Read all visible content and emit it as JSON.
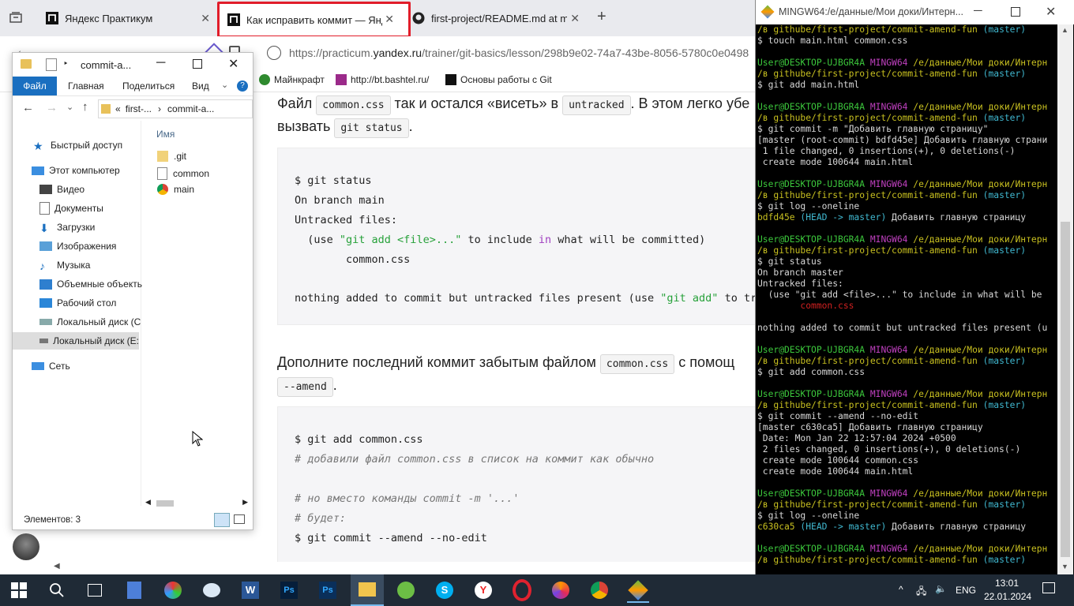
{
  "browser": {
    "tabs": [
      {
        "title": "Яндекс Практикум"
      },
      {
        "title": "Как исправить коммит — Яндекс"
      },
      {
        "title": "first-project/README.md at main"
      }
    ],
    "url_domain": "https://practicum.",
    "url_bold": "yandex.ru",
    "url_path": "/trainer/git-basics/lesson/298b9e02-74a7-43be-8056-5780c0e0498",
    "bookmarks": [
      "Майнкрафт",
      "http://bt.bashtel.ru/",
      "Основы работы с Git"
    ]
  },
  "lesson": {
    "p1_a": "Файл ",
    "p1_code1": "common.css",
    "p1_b": " так и остался «висеть» в ",
    "p1_code2": "untracked",
    "p1_c": ". В этом легко убе",
    "p1_d": "вызвать ",
    "p1_code3": "git status",
    "p1_e": ".",
    "code1": {
      "l1": "$ git status",
      "l2": "On branch main",
      "l3": "Untracked files:",
      "l4a": "  (use ",
      "l4b": "\"git add <file>...\"",
      "l4c": " to include ",
      "l4d": "in",
      "l4e": " what will be committed)",
      "l5": "        common.css",
      "l6a": "nothing added to commit but untracked files present (use ",
      "l6b": "\"git add\"",
      "l6c": " to tra"
    },
    "p2_a": "Дополните последний коммит забытым файлом ",
    "p2_code1": "common.css",
    "p2_b": " с помощ",
    "p2_code2": "--amend",
    "p2_c": ".",
    "code2": {
      "l1": "$ git add common.css",
      "l2": "# добавили файл common.css в список на коммит как обычно",
      "l3": "# но вместо команды commit -m '...'",
      "l4": "# будет:",
      "l5": "$ git commit --amend --no-edit"
    }
  },
  "explorer": {
    "title": "commit-a...",
    "ribbon": {
      "file": "Файл",
      "home": "Главная",
      "share": "Поделиться",
      "view": "Вид"
    },
    "path_prefix": "«",
    "path_a": "first-...",
    "path_b": "commit-a...",
    "tree": [
      {
        "label": "Быстрый доступ"
      },
      {
        "label": "Этот компьютер"
      },
      {
        "label": "Видео"
      },
      {
        "label": "Документы"
      },
      {
        "label": "Загрузки"
      },
      {
        "label": "Изображения"
      },
      {
        "label": "Музыка"
      },
      {
        "label": "Объемные объекть"
      },
      {
        "label": "Рабочий стол"
      },
      {
        "label": "Локальный диск (C"
      },
      {
        "label": "Локальный диск (E:"
      },
      {
        "label": "Сеть"
      }
    ],
    "column_name": "Имя",
    "files": [
      ".git",
      "common",
      "main"
    ],
    "status": "Элементов: 3"
  },
  "terminal": {
    "title": "MINGW64:/e/данные/Мои доки/Интерн...",
    "user": "User@DESKTOP-UJBGR4A",
    "mingw": "MINGW64",
    "cwd": "/e/данные/Мои доки/Интерн",
    "cwd2": "/в githube/first-project/commit-amend-fun",
    "branch": "(master)",
    "commands": {
      "c0": "$ touch main.html common.css",
      "c1": "$ git add main.html",
      "c2": "$ git commit -m \"Добавить главную страницу\"",
      "o2a": "[master (root-commit) bdfd45e] Добавить главную страни",
      "o2b": " 1 file changed, 0 insertions(+), 0 deletions(-)",
      "o2c": " create mode 100644 main.html",
      "c3": "$ git log --oneline",
      "o3hash": "bdfd45e",
      "o3head": "(HEAD -> master)",
      "o3msg": " Добавить главную страницу",
      "c4": "$ git status",
      "o4a": "On branch master",
      "o4b": "Untracked files:",
      "o4c": "  (use \"git add <file>...\" to include in what will be",
      "o4d": "        common.css",
      "o4e": "nothing added to commit but untracked files present (u",
      "c5": "$ git add common.css",
      "c6": "$ git commit --amend --no-edit",
      "o6a": "[master c630ca5] Добавить главную страницу",
      "o6b": " Date: Mon Jan 22 12:57:04 2024 +0500",
      "o6c": " 2 files changed, 0 insertions(+), 0 deletions(-)",
      "o6d": " create mode 100644 common.css",
      "o6e": " create mode 100644 main.html",
      "c7": "$ git log --oneline",
      "o7hash": "c630ca5",
      "o7head": "(HEAD -> master)",
      "o7msg": " Добавить главную страницу"
    }
  },
  "taskbar": {
    "lang": "ENG",
    "time": "13:01",
    "date": "22.01.2024"
  },
  "colors": {
    "accent": "#1a6fc0",
    "highlight": "#e11d2a",
    "taskbar": "#1f2a36"
  }
}
